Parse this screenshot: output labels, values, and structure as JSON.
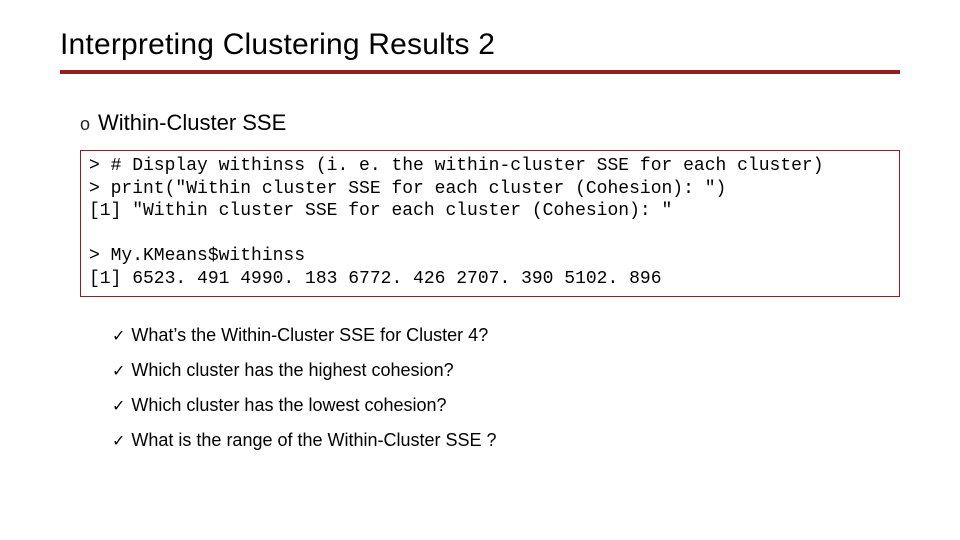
{
  "title": "Interpreting Clustering Results 2",
  "subheading": "Within-Cluster SSE",
  "code": {
    "l1": "> # Display withinss (i. e. the within-cluster SSE for each cluster)",
    "l2": "> print(\"Within cluster SSE for each cluster (Cohesion): \")",
    "l3": "[1] \"Within cluster SSE for each cluster (Cohesion): \"",
    "l4": "",
    "l5": "> My.KMeans$withinss",
    "l6": "[1] 6523. 491 4990. 183 6772. 426 2707. 390 5102. 896"
  },
  "questions": {
    "q1": "What’s the Within-Cluster SSE for Cluster 4?",
    "q2": "Which cluster has the highest cohesion?",
    "q3": "Which cluster has the lowest cohesion?",
    "q4": "What is the range of the Within-Cluster SSE ?"
  },
  "colors": {
    "accent": "#9a1b1b"
  }
}
